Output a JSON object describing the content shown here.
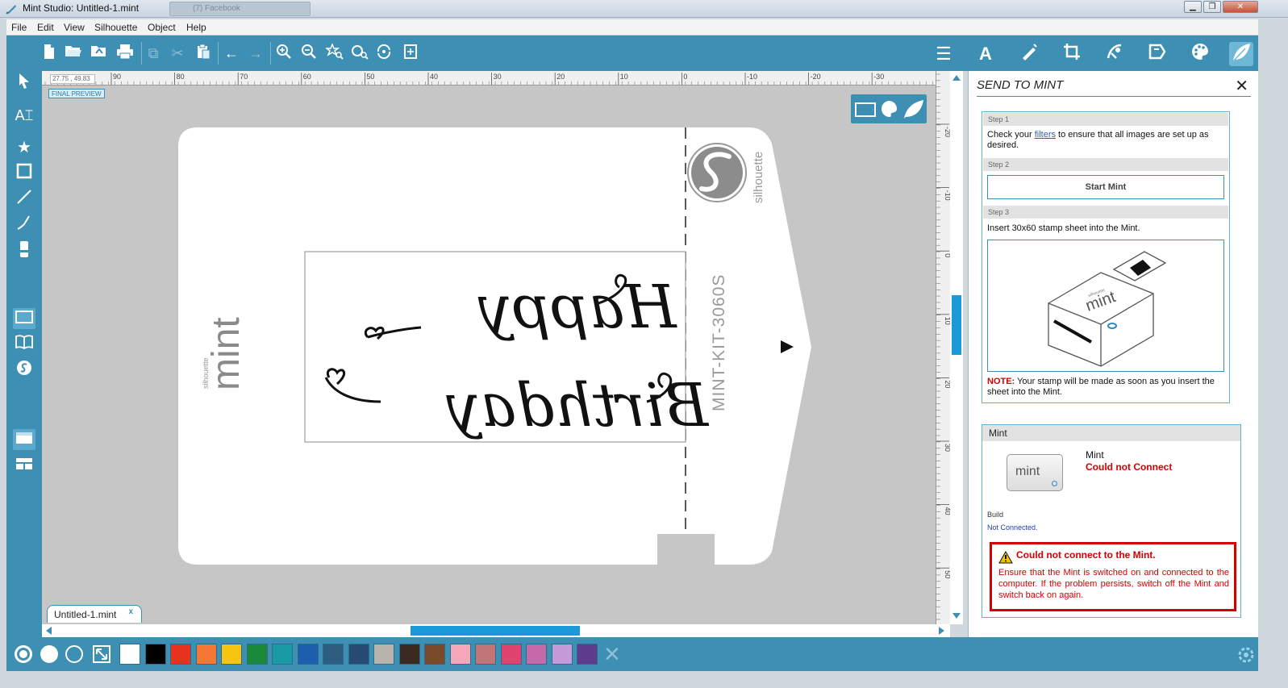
{
  "window": {
    "title": "Mint Studio: Untitled-1.mint",
    "ghost_tab": "(7) Facebook",
    "minimize": "▁",
    "restore": "❐",
    "close": "✕"
  },
  "menu": [
    "File",
    "Edit",
    "View",
    "Silhouette",
    "Object",
    "Help"
  ],
  "canvas": {
    "final_preview": "FINAL PREVIEW",
    "coords": "27.75 , 49.83",
    "ruler_h": [
      "90",
      "80",
      "70",
      "60",
      "50",
      "40",
      "30",
      "20",
      "10",
      "0",
      "-10",
      "-20",
      "-30"
    ],
    "ruler_v": [
      "-20",
      "-10",
      "0",
      "10",
      "20",
      "30",
      "40",
      "50"
    ],
    "sheet_brand_small": "silhouette",
    "sheet_brand": "mint",
    "sheet_kit": "MINT-KIT-3060S",
    "sheet_logo_text": "silhouette",
    "stamp_line1": "Happy",
    "stamp_line2": "Birthday"
  },
  "doc_tab": {
    "name": "Untitled-1.mint",
    "close": "x"
  },
  "colors": [
    "#ffffff",
    "#000000",
    "#e8311f",
    "#f57736",
    "#f7c40f",
    "#1a8a3a",
    "#1a9aa5",
    "#1d5fae",
    "#2e5d80",
    "#264a72",
    "#b8b3ad",
    "#3a2a1f",
    "#7b4a2a",
    "#f4a7b9",
    "#c07676",
    "#e0446e",
    "#c46aa8",
    "#c59ad9",
    "#5e3b8c"
  ],
  "panel": {
    "title": "SEND TO MINT",
    "close": "✕",
    "step1_head": "Step 1",
    "step1_text_a": "Check your ",
    "step1_link": "filters",
    "step1_text_b": " to ensure that all images are set up as desired.",
    "step2_head": "Step 2",
    "start_button": "Start Mint",
    "step3_head": "Step 3",
    "step3_text": "Insert 30x60 stamp sheet into the Mint.",
    "device_brand": "mint",
    "device_brand_small": "silhouette",
    "note_label": "NOTE:",
    "note_text": " Your stamp will be made as soon as you insert the sheet into the Mint.",
    "mint_head": "Mint",
    "mint_thumb_label": "mint",
    "mint_name": "Mint",
    "mint_status": "Could not Connect",
    "build_label": "Build",
    "build_value": "Not Connected.",
    "error_title": "Could not connect to the Mint.",
    "error_body": "Ensure that the Mint is switched on and connected to the computer. If the problem persists, switch off the Mint and switch back on again."
  }
}
